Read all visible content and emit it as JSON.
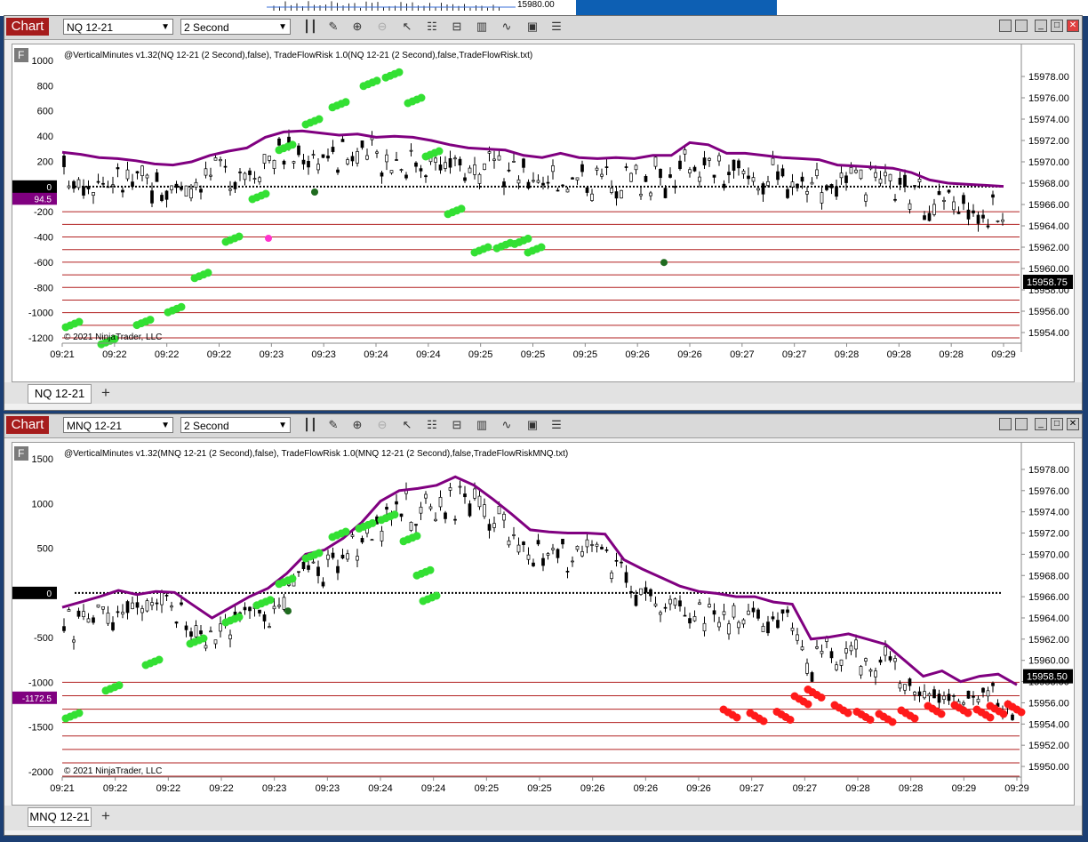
{
  "background": {
    "top_price_label": "15980.00"
  },
  "icons": [
    "bar-type-icon",
    "drawing-tool-icon",
    "zoom-in-icon",
    "zoom-out-icon",
    "pointer-icon",
    "data-box-icon",
    "chart-properties-icon",
    "strategies-icon",
    "indicators-icon",
    "templates-icon",
    "menu-icon"
  ],
  "charts": [
    {
      "window_title": "Chart",
      "instrument": "NQ 12-21",
      "interval": "2 Second",
      "indicator_text": "@VerticalMinutes v1.32(NQ 12-21 (2 Second),false), TradeFlowRisk 1.0(NQ 12-21 (2 Second),false,TradeFlowRisk.txt)",
      "copyright": "© 2021 NinjaTrader, LLC",
      "flag_label": "F",
      "left_axis_labels": [
        "1000",
        "800",
        "600",
        "400",
        "200",
        "0",
        "-200",
        "-400",
        "-600",
        "-800",
        "-1000",
        "-1200"
      ],
      "left_badges": [
        {
          "text": "94.5",
          "color": "#800080"
        },
        {
          "text": "0",
          "color": "#000000"
        }
      ],
      "right_axis_labels": [
        "15978.00",
        "15976.00",
        "15974.00",
        "15972.00",
        "15970.00",
        "15968.00",
        "15966.00",
        "15964.00",
        "15962.00",
        "15960.00",
        "15958.00",
        "15956.00",
        "15954.00"
      ],
      "last_price": "15958.75",
      "time_labels": [
        "09:21",
        "09:22",
        "09:22",
        "09:22",
        "09:23",
        "09:23",
        "09:24",
        "09:24",
        "09:25",
        "09:25",
        "09:25",
        "09:26",
        "09:26",
        "09:27",
        "09:27",
        "09:28",
        "09:28",
        "09:28",
        "09:29"
      ],
      "tab_label": "NQ 12-21",
      "colors": {
        "indicator_line": "#800080",
        "buy_marker": "#33e033",
        "sell_marker": "#ff1a1a",
        "level_line": "#b22222"
      },
      "chart_data": {
        "type": "line",
        "title": "",
        "price_range": [
          15953.5,
          15979.5
        ],
        "delta_range": [
          -1200,
          1000
        ],
        "last_price": 15958.75,
        "series": [
          {
            "values": [
              15970.9,
              15970.7,
              15970.4,
              15970.3,
              15970.1,
              15969.8,
              15969.7,
              15970.0,
              15970.6,
              15971.0,
              15971.3,
              15972.3,
              15972.8,
              15972.9,
              15972.7,
              15972.5,
              15972.6,
              15972.3,
              15972.4,
              15972.3,
              15972.0,
              15971.6,
              15971.3,
              15971.2,
              15971.1,
              15970.6,
              15970.4,
              15970.8,
              15970.4,
              15970.3,
              15970.4,
              15970.3,
              15970.6,
              15970.6,
              15971.8,
              15971.6,
              15970.8,
              15970.8,
              15970.6,
              15970.4,
              15970.3,
              15970.2,
              15969.7,
              15969.6,
              15969.5,
              15969.4,
              15969.0,
              15968.3,
              15968.0,
              15967.9,
              15967.8,
              15967.7
            ]
          }
        ]
      }
    },
    {
      "window_title": "Chart",
      "instrument": "MNQ 12-21",
      "interval": "2 Second",
      "indicator_text": "@VerticalMinutes v1.32(MNQ 12-21 (2 Second),false), TradeFlowRisk 1.0(MNQ 12-21 (2 Second),false,TradeFlowRiskMNQ.txt)",
      "copyright": "© 2021 NinjaTrader, LLC",
      "flag_label": "F",
      "left_axis_labels": [
        "1500",
        "1000",
        "500",
        "0",
        "-500",
        "-1000",
        "-1500",
        "-2000"
      ],
      "left_badges": [
        {
          "text": "0",
          "color": "#000000"
        },
        {
          "text": "-1172.5",
          "color": "#800080"
        }
      ],
      "right_axis_labels": [
        "15978.00",
        "15976.00",
        "15974.00",
        "15972.00",
        "15970.00",
        "15968.00",
        "15966.00",
        "15964.00",
        "15962.00",
        "15960.00",
        "15958.00",
        "15956.00",
        "15954.00",
        "15952.00",
        "15950.00"
      ],
      "last_price": "15958.50",
      "time_labels": [
        "09:21",
        "09:22",
        "09:22",
        "09:22",
        "09:23",
        "09:23",
        "09:24",
        "09:24",
        "09:25",
        "09:25",
        "09:26",
        "09:26",
        "09:26",
        "09:27",
        "09:27",
        "09:28",
        "09:28",
        "09:29",
        "09:29"
      ],
      "tab_label": "MNQ 12-21",
      "colors": {
        "indicator_line": "#800080",
        "buy_marker": "#33e033",
        "sell_marker": "#ff1a1a",
        "level_line": "#b22222"
      },
      "chart_data": {
        "type": "line",
        "title": "",
        "price_range": [
          15949.5,
          15979
        ],
        "delta_range": [
          -2000,
          1500
        ],
        "last_price": 15958.5,
        "series": [
          {
            "values": [
              15965.0,
              15965.5,
              15966.0,
              15966.6,
              15966.2,
              15966.5,
              15966.4,
              15965.2,
              15964.0,
              15965.0,
              15966.0,
              15966.8,
              15968.2,
              15970.0,
              15970.4,
              15971.5,
              15973.0,
              15975.0,
              15976.0,
              15976.2,
              15976.5,
              15977.3,
              15976.5,
              15975.2,
              15973.8,
              15972.3,
              15972.1,
              15972.0,
              15972.0,
              15971.9,
              15969.5,
              15968.6,
              15967.8,
              15967.0,
              15966.5,
              15966.3,
              15966.0,
              15966.0,
              15965.5,
              15965.3,
              15962.0,
              15962.2,
              15962.5,
              15962.0,
              15961.5,
              15960.0,
              15958.5,
              15959.0,
              15958.0,
              15958.5,
              15958.7,
              15957.7
            ]
          }
        ]
      }
    }
  ]
}
